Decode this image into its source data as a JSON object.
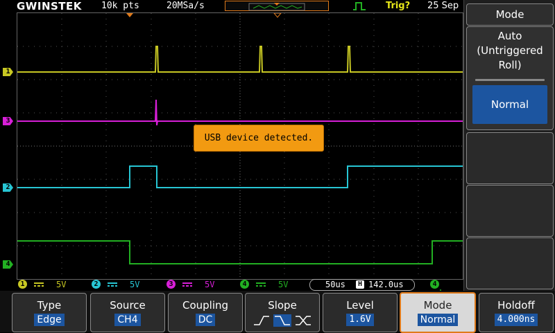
{
  "top_bar": {
    "logo": "GWINSTEK",
    "record_length": "10k pts",
    "sample_rate": "20MSa/s",
    "trigger_status": "Trig?",
    "date": "25 Sep"
  },
  "channels": [
    {
      "id": "1",
      "color": "#c8c823",
      "volts": "5V"
    },
    {
      "id": "2",
      "color": "#27c6d4",
      "volts": "5V"
    },
    {
      "id": "3",
      "color": "#d81fd8",
      "volts": "5V"
    },
    {
      "id": "4",
      "color": "#22b022",
      "volts": "5V"
    }
  ],
  "markers": {
    "ch1": "1",
    "ch2": "2",
    "ch3": "3",
    "ch4": "4"
  },
  "timebase": {
    "scale": "50us",
    "h_icon": "H",
    "delay": "142.0us"
  },
  "trigger_info": {
    "source": "4",
    "slope_icon": "falling-edge-icon"
  },
  "trigger_level_marker": "F",
  "message": "USB device detected.",
  "side_menu": {
    "title": "Mode",
    "auto_label": "Auto\n(Untriggered\nRoll)",
    "normal_label": "Normal"
  },
  "soft_keys": [
    {
      "label": "Type",
      "value": "Edge"
    },
    {
      "label": "Source",
      "value": "CH4"
    },
    {
      "label": "Coupling",
      "value": "DC"
    },
    {
      "label": "Slope",
      "value": ""
    },
    {
      "label": "Level",
      "value": "1.6V"
    },
    {
      "label": "Mode",
      "value": "Normal"
    },
    {
      "label": "Holdoff",
      "value": "4.000ns"
    }
  ],
  "colors": {
    "accent": "#e07a1a",
    "selected": "#1c55a0",
    "message_bg": "#f29a11"
  }
}
